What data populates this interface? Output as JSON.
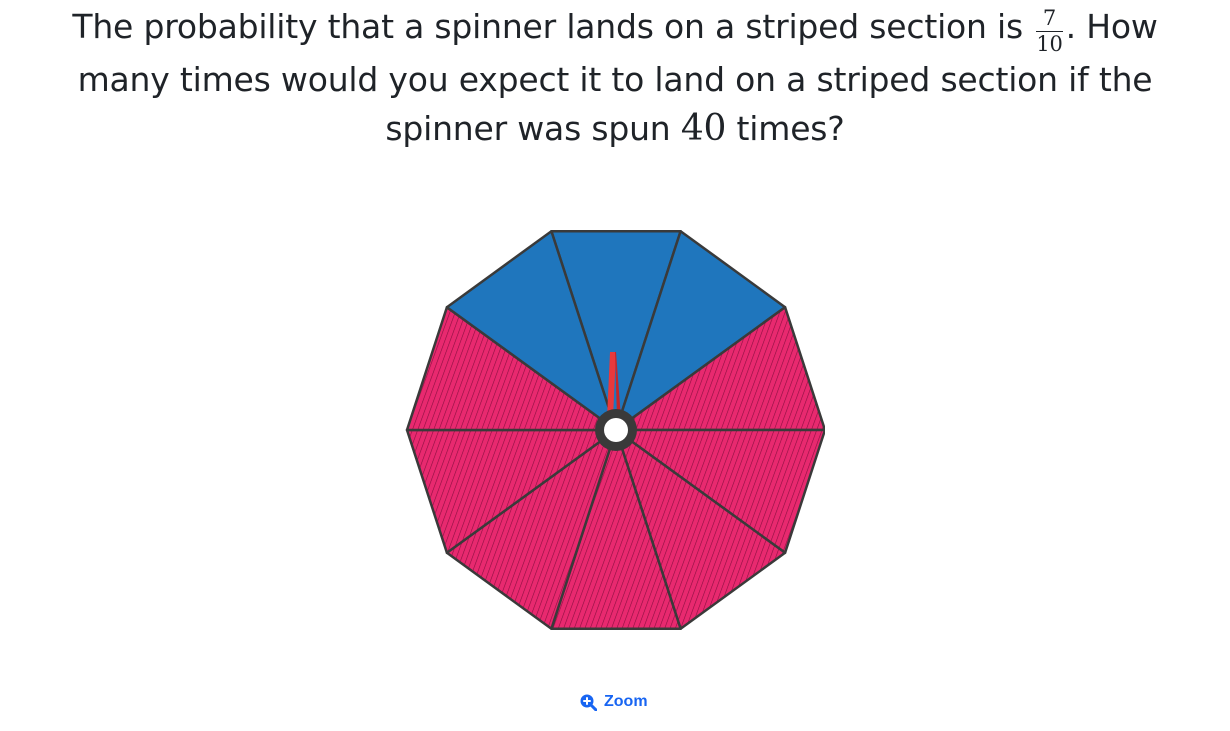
{
  "question": {
    "part1": "The probability that a spinner lands on a striped section is",
    "fraction_numerator": "7",
    "fraction_denominator": "10",
    "part2": ". How many times would you expect it to land on a striped section if the spinner was spun",
    "spins": "40",
    "part3": "times?"
  },
  "spinner": {
    "sections": 10,
    "striped_sections": 7,
    "solid_sections": 3,
    "solid_color": "#1f76bd",
    "striped_color": "#e8296f",
    "stripe_color": "#8a1040",
    "outline_color": "#3a3a3a",
    "pointer_color": "#e8393c"
  },
  "zoom": {
    "label": "Zoom",
    "icon": "zoom-in-icon"
  }
}
